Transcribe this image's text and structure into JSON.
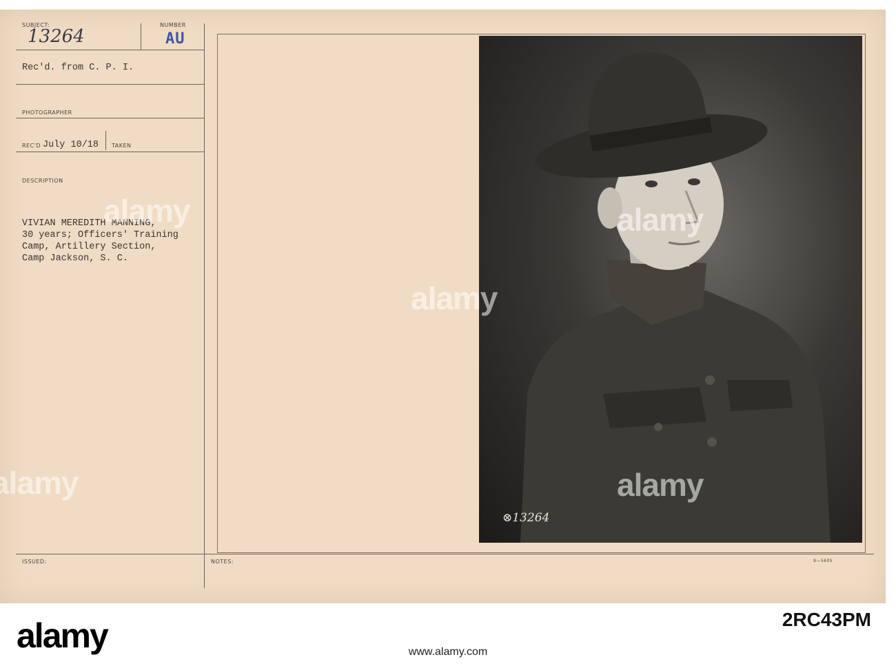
{
  "card": {
    "subject_label": "SUBJECT:",
    "subject_value": "13264",
    "number_label": "NUMBER",
    "number_stamp": "AU",
    "received_from": "Rec'd. from C. P. I.",
    "photographer_label": "PHOTOGRAPHER",
    "recd_label": "REC'D",
    "recd_date": "July 10/18",
    "taken_label": "TAKEN",
    "description_label": "DESCRIPTION",
    "description_lines": [
      "VIVIAN MEREDITH MANNING,",
      "30 years; Officers' Training",
      "Camp, Artillery Section,",
      "Camp Jackson, S. C."
    ],
    "issued_label": "ISSUED:",
    "notes_label": "NOTES:",
    "form_code": "9—5605"
  },
  "photo": {
    "negative_number": "⊗13264"
  },
  "watermark": {
    "text": "alamy",
    "image_id": "2RC43PM",
    "url": "www.alamy.com"
  },
  "colors": {
    "card": "#f0dcc4",
    "stamp": "#3d56a8",
    "ink": "#3a3430"
  }
}
